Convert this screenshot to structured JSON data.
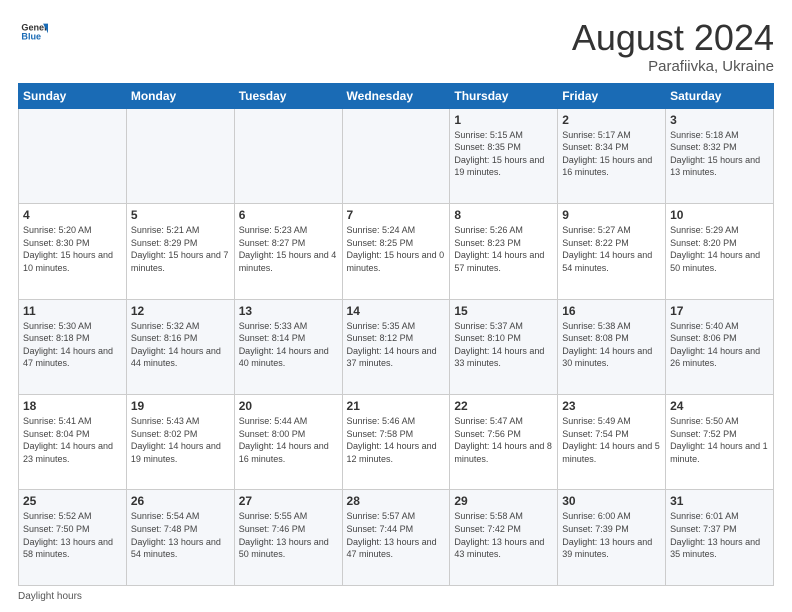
{
  "logo": {
    "line1": "General",
    "line2": "Blue"
  },
  "title": "August 2024",
  "subtitle": "Parafiivka, Ukraine",
  "weekdays": [
    "Sunday",
    "Monday",
    "Tuesday",
    "Wednesday",
    "Thursday",
    "Friday",
    "Saturday"
  ],
  "weeks": [
    [
      {
        "day": "",
        "sunrise": "",
        "sunset": "",
        "daylight": ""
      },
      {
        "day": "",
        "sunrise": "",
        "sunset": "",
        "daylight": ""
      },
      {
        "day": "",
        "sunrise": "",
        "sunset": "",
        "daylight": ""
      },
      {
        "day": "",
        "sunrise": "",
        "sunset": "",
        "daylight": ""
      },
      {
        "day": "1",
        "sunrise": "5:15 AM",
        "sunset": "8:35 PM",
        "daylight": "15 hours and 19 minutes."
      },
      {
        "day": "2",
        "sunrise": "5:17 AM",
        "sunset": "8:34 PM",
        "daylight": "15 hours and 16 minutes."
      },
      {
        "day": "3",
        "sunrise": "5:18 AM",
        "sunset": "8:32 PM",
        "daylight": "15 hours and 13 minutes."
      }
    ],
    [
      {
        "day": "4",
        "sunrise": "5:20 AM",
        "sunset": "8:30 PM",
        "daylight": "15 hours and 10 minutes."
      },
      {
        "day": "5",
        "sunrise": "5:21 AM",
        "sunset": "8:29 PM",
        "daylight": "15 hours and 7 minutes."
      },
      {
        "day": "6",
        "sunrise": "5:23 AM",
        "sunset": "8:27 PM",
        "daylight": "15 hours and 4 minutes."
      },
      {
        "day": "7",
        "sunrise": "5:24 AM",
        "sunset": "8:25 PM",
        "daylight": "15 hours and 0 minutes."
      },
      {
        "day": "8",
        "sunrise": "5:26 AM",
        "sunset": "8:23 PM",
        "daylight": "14 hours and 57 minutes."
      },
      {
        "day": "9",
        "sunrise": "5:27 AM",
        "sunset": "8:22 PM",
        "daylight": "14 hours and 54 minutes."
      },
      {
        "day": "10",
        "sunrise": "5:29 AM",
        "sunset": "8:20 PM",
        "daylight": "14 hours and 50 minutes."
      }
    ],
    [
      {
        "day": "11",
        "sunrise": "5:30 AM",
        "sunset": "8:18 PM",
        "daylight": "14 hours and 47 minutes."
      },
      {
        "day": "12",
        "sunrise": "5:32 AM",
        "sunset": "8:16 PM",
        "daylight": "14 hours and 44 minutes."
      },
      {
        "day": "13",
        "sunrise": "5:33 AM",
        "sunset": "8:14 PM",
        "daylight": "14 hours and 40 minutes."
      },
      {
        "day": "14",
        "sunrise": "5:35 AM",
        "sunset": "8:12 PM",
        "daylight": "14 hours and 37 minutes."
      },
      {
        "day": "15",
        "sunrise": "5:37 AM",
        "sunset": "8:10 PM",
        "daylight": "14 hours and 33 minutes."
      },
      {
        "day": "16",
        "sunrise": "5:38 AM",
        "sunset": "8:08 PM",
        "daylight": "14 hours and 30 minutes."
      },
      {
        "day": "17",
        "sunrise": "5:40 AM",
        "sunset": "8:06 PM",
        "daylight": "14 hours and 26 minutes."
      }
    ],
    [
      {
        "day": "18",
        "sunrise": "5:41 AM",
        "sunset": "8:04 PM",
        "daylight": "14 hours and 23 minutes."
      },
      {
        "day": "19",
        "sunrise": "5:43 AM",
        "sunset": "8:02 PM",
        "daylight": "14 hours and 19 minutes."
      },
      {
        "day": "20",
        "sunrise": "5:44 AM",
        "sunset": "8:00 PM",
        "daylight": "14 hours and 16 minutes."
      },
      {
        "day": "21",
        "sunrise": "5:46 AM",
        "sunset": "7:58 PM",
        "daylight": "14 hours and 12 minutes."
      },
      {
        "day": "22",
        "sunrise": "5:47 AM",
        "sunset": "7:56 PM",
        "daylight": "14 hours and 8 minutes."
      },
      {
        "day": "23",
        "sunrise": "5:49 AM",
        "sunset": "7:54 PM",
        "daylight": "14 hours and 5 minutes."
      },
      {
        "day": "24",
        "sunrise": "5:50 AM",
        "sunset": "7:52 PM",
        "daylight": "14 hours and 1 minute."
      }
    ],
    [
      {
        "day": "25",
        "sunrise": "5:52 AM",
        "sunset": "7:50 PM",
        "daylight": "13 hours and 58 minutes."
      },
      {
        "day": "26",
        "sunrise": "5:54 AM",
        "sunset": "7:48 PM",
        "daylight": "13 hours and 54 minutes."
      },
      {
        "day": "27",
        "sunrise": "5:55 AM",
        "sunset": "7:46 PM",
        "daylight": "13 hours and 50 minutes."
      },
      {
        "day": "28",
        "sunrise": "5:57 AM",
        "sunset": "7:44 PM",
        "daylight": "13 hours and 47 minutes."
      },
      {
        "day": "29",
        "sunrise": "5:58 AM",
        "sunset": "7:42 PM",
        "daylight": "13 hours and 43 minutes."
      },
      {
        "day": "30",
        "sunrise": "6:00 AM",
        "sunset": "7:39 PM",
        "daylight": "13 hours and 39 minutes."
      },
      {
        "day": "31",
        "sunrise": "6:01 AM",
        "sunset": "7:37 PM",
        "daylight": "13 hours and 35 minutes."
      }
    ]
  ],
  "footer": "Daylight hours"
}
